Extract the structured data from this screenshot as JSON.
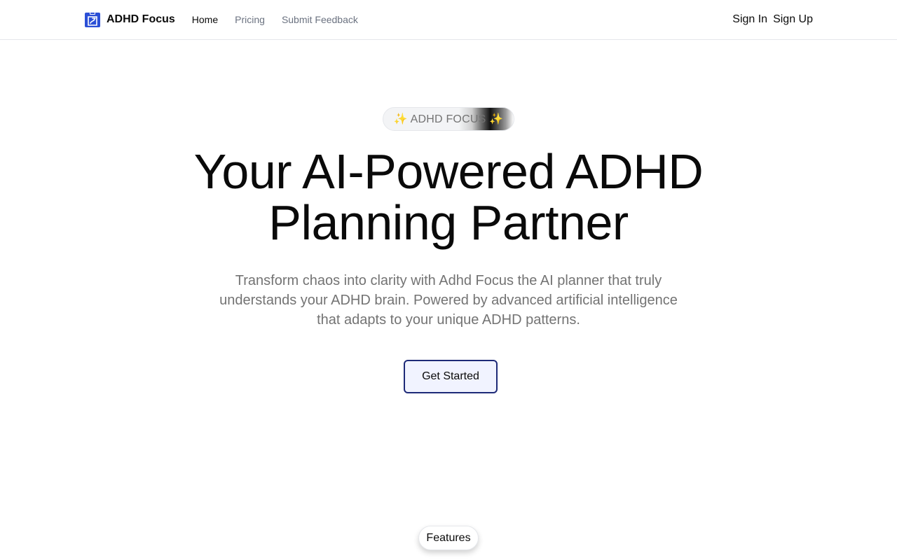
{
  "nav": {
    "brand": "ADHD Focus",
    "logo_icon": "clipboard-logo-icon",
    "links": [
      {
        "label": "Home",
        "active": true
      },
      {
        "label": "Pricing",
        "active": false
      },
      {
        "label": "Submit Feedback",
        "active": false
      }
    ],
    "sign_in": "Sign In",
    "sign_up": "Sign Up"
  },
  "hero": {
    "badge": "✨ ADHD FOCUS ✨",
    "title_line1": "Your AI-Powered ADHD",
    "title_line2": "Planning Partner",
    "subtitle": "Transform chaos into clarity with Adhd Focus the AI planner that truly understands your ADHD brain. Powered by advanced artificial intelligence that adapts to your unique ADHD patterns.",
    "cta": "Get Started"
  },
  "features_tab": "Features",
  "colors": {
    "brand_blue": "#2b4fd6",
    "cta_border": "#1e2a78",
    "cta_bg": "#f1f3ff",
    "muted_text": "#737373"
  }
}
